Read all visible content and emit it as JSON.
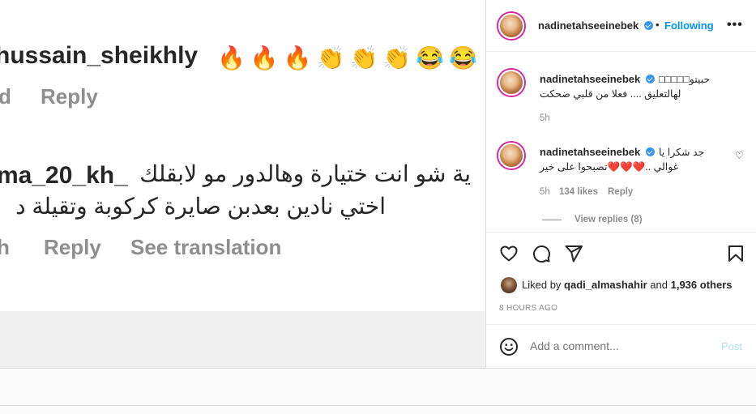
{
  "background_comments": {
    "comment1_user": "hussain_sheikhly",
    "comment1_emojis": "🔥🔥🔥👏👏👏😂😂",
    "comment1_time": "d",
    "comment1_reply": "Reply",
    "comment2_user": "ma_20_kh_",
    "comment2_line1": "ية شو انت ختيارة وهالدور مو لابقلك",
    "comment2_line2": "اختي نادين بعدبن صايرة كركوبة وتقيلة د",
    "comment2_time": "h",
    "comment2_reply": "Reply",
    "comment2_translate": "See translation"
  },
  "header": {
    "username": "nadinetahseeinebek",
    "dot": "•",
    "following": "Following",
    "more": "•••"
  },
  "comments": [
    {
      "username": "nadinetahseeinebek",
      "line1": "حبيتو□□□□□",
      "line2": "لهالتعليق .... فعلا من قلبي ضحكت",
      "time": "5h"
    },
    {
      "username": "nadinetahseeinebek",
      "line1": "جد شكرا يا",
      "line2": "غوالي ..❤️❤️❤️تصبحوا على خير",
      "time": "5h",
      "likes": "134 likes",
      "reply": "Reply",
      "view_replies": "View replies (8)"
    }
  ],
  "actions": {
    "liked_prefix": "Liked by",
    "liked_user": "qadi_almashahir",
    "liked_and": "and",
    "liked_others": "1,936 others",
    "timestamp": "8 HOURS AGO"
  },
  "add_comment": {
    "placeholder": "Add a comment...",
    "post": "Post"
  },
  "colors": {
    "accent": "#0095f6",
    "post_disabled": "#b2dffc",
    "muted": "#8e8e8e",
    "text": "#262626"
  },
  "icons": [
    "heart-icon",
    "comment-icon",
    "share-icon",
    "bookmark-icon",
    "emoji-icon",
    "verified-icon",
    "more-icon"
  ]
}
